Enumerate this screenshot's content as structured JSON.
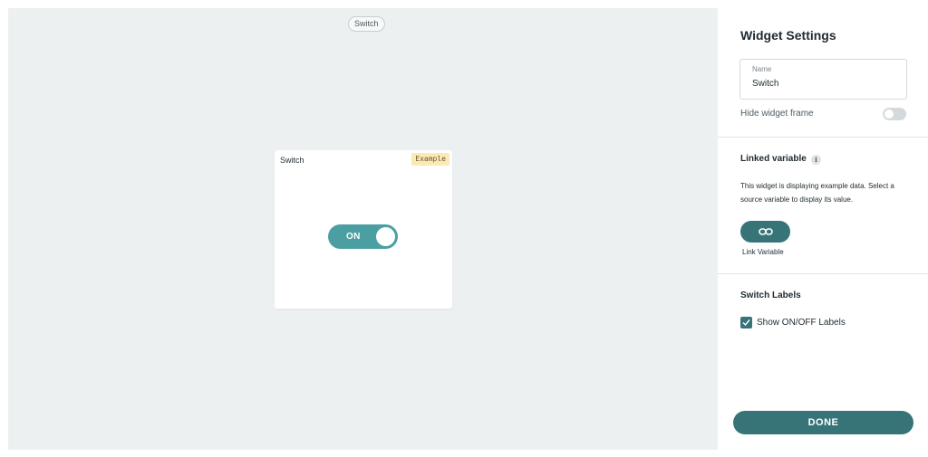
{
  "canvas": {
    "widget_type_pill": "Switch",
    "widget": {
      "title": "Switch",
      "example_badge": "Example",
      "toggle_label": "ON",
      "toggle_state": "on"
    }
  },
  "settings": {
    "title": "Widget Settings",
    "name_field": {
      "label": "Name",
      "value": "Switch"
    },
    "hide_frame": {
      "label": "Hide widget frame",
      "enabled": false
    },
    "linked_variable": {
      "title": "Linked variable",
      "info_icon": "i",
      "description": "This widget is displaying example data. Select a source variable to display its value.",
      "button_icon": "link-icon",
      "button_label": "Link Variable"
    },
    "switch_labels": {
      "title": "Switch Labels",
      "checkbox_label": "Show ON/OFF Labels",
      "checked": true
    },
    "done_label": "DONE"
  },
  "colors": {
    "accent": "#377478",
    "toggle_on": "#4b9fa2",
    "canvas_bg": "#edf0f1",
    "example_badge_bg": "#fbe9b7"
  }
}
